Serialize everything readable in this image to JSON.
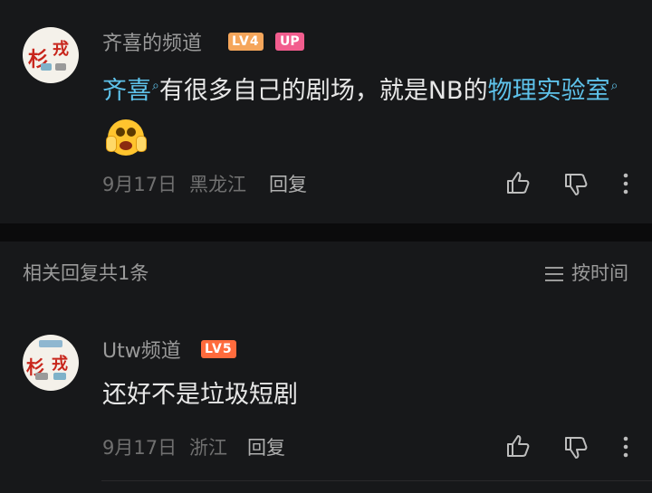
{
  "comment": {
    "username": "齐喜的频道",
    "level": "LV4",
    "up_badge": "UP",
    "content": {
      "link1": "齐喜",
      "text1": "有很多自己的剧场，就是NB的",
      "link2": "物理实验室"
    },
    "date": "9月17日",
    "location": "黑龙江",
    "reply_label": "回复"
  },
  "replies_header": {
    "title": "相关回复共1条",
    "sort_label": "按时间"
  },
  "reply": {
    "username": "Utw频道",
    "level": "LV5",
    "content": "还好不是垃圾短剧",
    "date": "9月17日",
    "location": "浙江",
    "reply_label": "回复"
  },
  "colors": {
    "background": "#17181a",
    "link": "#5ec2ea",
    "lv4": "#f5a65b",
    "lv5": "#ff6b3d",
    "up": "#f25d8e"
  },
  "icons": [
    "avatar",
    "search-icon",
    "emoji-surprised-icon",
    "thumb-up-icon",
    "thumb-down-icon",
    "more-vertical-icon",
    "sort-lines-icon"
  ]
}
